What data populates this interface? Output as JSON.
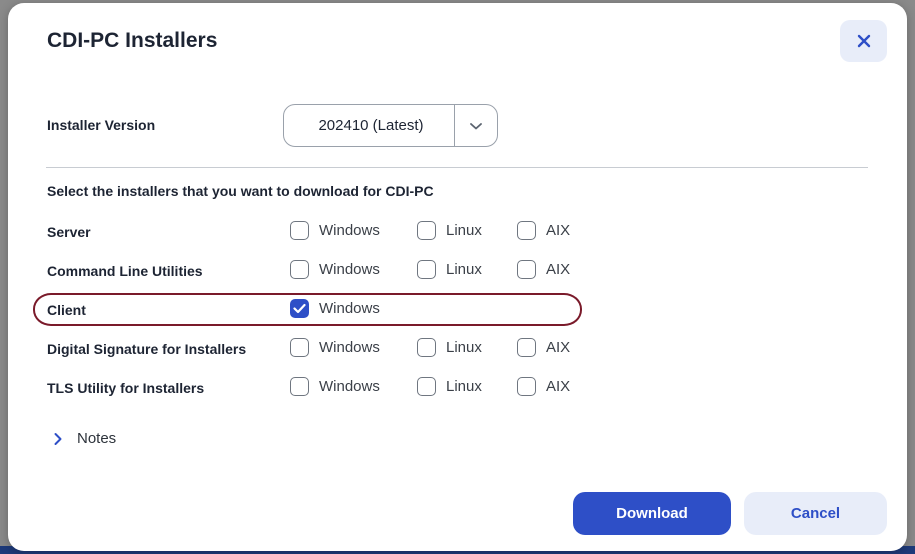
{
  "dialog": {
    "title": "CDI-PC Installers",
    "close_icon": "close-icon",
    "accent_color": "#2e4fc7",
    "highlight_color": "#7a1a2a"
  },
  "version": {
    "label": "Installer Version",
    "selected": "202410 (Latest)",
    "chevron_icon": "chevron-down-icon"
  },
  "selection": {
    "heading": "Select the installers that you want to download for CDI-PC",
    "rows": [
      {
        "label": "Server",
        "options": [
          {
            "label": "Windows",
            "checked": false
          },
          {
            "label": "Linux",
            "checked": false
          },
          {
            "label": "AIX",
            "checked": false
          }
        ]
      },
      {
        "label": "Command Line Utilities",
        "options": [
          {
            "label": "Windows",
            "checked": false
          },
          {
            "label": "Linux",
            "checked": false
          },
          {
            "label": "AIX",
            "checked": false
          }
        ]
      },
      {
        "label": "Client",
        "options": [
          {
            "label": "Windows",
            "checked": true
          }
        ]
      },
      {
        "label": "Digital Signature for Installers",
        "options": [
          {
            "label": "Windows",
            "checked": false
          },
          {
            "label": "Linux",
            "checked": false
          },
          {
            "label": "AIX",
            "checked": false
          }
        ]
      },
      {
        "label": "TLS Utility for Installers",
        "options": [
          {
            "label": "Windows",
            "checked": false
          },
          {
            "label": "Linux",
            "checked": false
          },
          {
            "label": "AIX",
            "checked": false
          }
        ]
      }
    ]
  },
  "notes": {
    "label": "Notes",
    "chevron_icon": "chevron-right-icon"
  },
  "footer": {
    "download_label": "Download",
    "cancel_label": "Cancel"
  }
}
